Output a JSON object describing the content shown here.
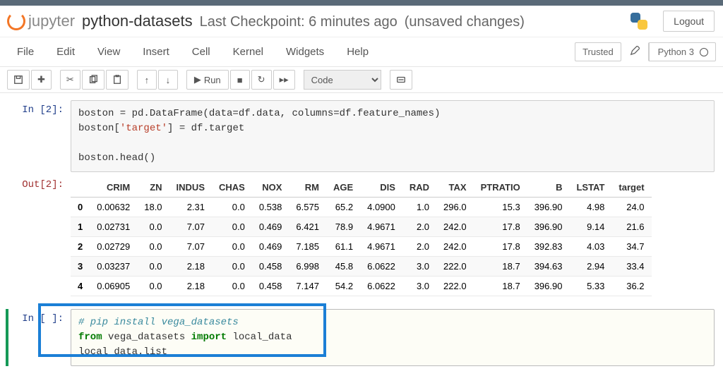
{
  "header": {
    "logo_text": "jupyter",
    "notebook_name": "python-datasets",
    "checkpoint_text": "Last Checkpoint: 6 minutes ago",
    "unsaved_text": "(unsaved changes)",
    "logout_label": "Logout"
  },
  "menubar": {
    "items": [
      "File",
      "Edit",
      "View",
      "Insert",
      "Cell",
      "Kernel",
      "Widgets",
      "Help"
    ],
    "trusted_label": "Trusted",
    "kernel_label": "Python 3"
  },
  "toolbar": {
    "run_label": "Run",
    "celltype_selected": "Code"
  },
  "cells": {
    "c0": {
      "in_prompt": "In [2]:",
      "out_prompt": "Out[2]:",
      "code_line1_a": "boston = pd.DataFrame(data=df.data, columns=df.feature_names)",
      "code_line2_a": "boston[",
      "code_line2_str": "'target'",
      "code_line2_b": "] = df.target",
      "code_line4": "boston.head()"
    },
    "c1": {
      "in_prompt": "In [ ]:",
      "comment": "# pip install vega_datasets",
      "line2_kw1": "from",
      "line2_mid": " vega_datasets ",
      "line2_kw2": "import",
      "line2_end": " local_data",
      "line3": "local_data.list_"
    }
  },
  "dataframe": {
    "columns": [
      "",
      "CRIM",
      "ZN",
      "INDUS",
      "CHAS",
      "NOX",
      "RM",
      "AGE",
      "DIS",
      "RAD",
      "TAX",
      "PTRATIO",
      "B",
      "LSTAT",
      "target"
    ],
    "rows": [
      [
        "0",
        "0.00632",
        "18.0",
        "2.31",
        "0.0",
        "0.538",
        "6.575",
        "65.2",
        "4.0900",
        "1.0",
        "296.0",
        "15.3",
        "396.90",
        "4.98",
        "24.0"
      ],
      [
        "1",
        "0.02731",
        "0.0",
        "7.07",
        "0.0",
        "0.469",
        "6.421",
        "78.9",
        "4.9671",
        "2.0",
        "242.0",
        "17.8",
        "396.90",
        "9.14",
        "21.6"
      ],
      [
        "2",
        "0.02729",
        "0.0",
        "7.07",
        "0.0",
        "0.469",
        "7.185",
        "61.1",
        "4.9671",
        "2.0",
        "242.0",
        "17.8",
        "392.83",
        "4.03",
        "34.7"
      ],
      [
        "3",
        "0.03237",
        "0.0",
        "2.18",
        "0.0",
        "0.458",
        "6.998",
        "45.8",
        "6.0622",
        "3.0",
        "222.0",
        "18.7",
        "394.63",
        "2.94",
        "33.4"
      ],
      [
        "4",
        "0.06905",
        "0.0",
        "2.18",
        "0.0",
        "0.458",
        "7.147",
        "54.2",
        "6.0622",
        "3.0",
        "222.0",
        "18.7",
        "396.90",
        "5.33",
        "36.2"
      ]
    ]
  }
}
